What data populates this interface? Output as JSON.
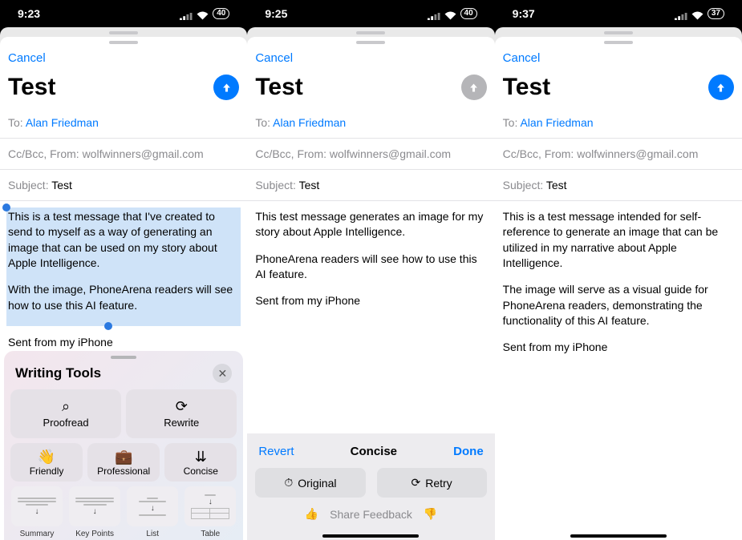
{
  "panels": [
    {
      "status": {
        "time": "9:23",
        "battery": "40"
      },
      "cancel": "Cancel",
      "title": "Test",
      "send_enabled": true,
      "to_label": "To:",
      "to_name": "Alan Friedman",
      "cc_label": "Cc/Bcc, From:",
      "cc_val": "wolfwinners@gmail.com",
      "subj_label": "Subject:",
      "subj_val": "Test",
      "body_selected": [
        "This is a test message that I've created to send to myself as a way of generating an image that can be used on my story about Apple Intelligence.",
        "With the image, PhoneArena readers will see how to use this AI feature."
      ],
      "signature": "Sent from my iPhone",
      "writing_tools": {
        "title": "Writing Tools",
        "proofread": "Proofread",
        "rewrite": "Rewrite",
        "friendly": "Friendly",
        "professional": "Professional",
        "concise": "Concise",
        "summary": "Summary",
        "key_points": "Key Points",
        "list": "List",
        "table": "Table"
      }
    },
    {
      "status": {
        "time": "9:25",
        "battery": "40"
      },
      "cancel": "Cancel",
      "title": "Test",
      "send_enabled": false,
      "to_label": "To:",
      "to_name": "Alan Friedman",
      "cc_label": "Cc/Bcc, From:",
      "cc_val": "wolfwinners@gmail.com",
      "subj_label": "Subject:",
      "subj_val": "Test",
      "body": [
        "This test message generates an image for my story about Apple Intelligence.",
        "PhoneArena readers will see how to use this AI feature.",
        "Sent from my iPhone"
      ],
      "concise_bar": {
        "revert": "Revert",
        "title": "Concise",
        "done": "Done",
        "original": "Original",
        "retry": "Retry",
        "share_feedback": "Share Feedback"
      }
    },
    {
      "status": {
        "time": "9:37",
        "battery": "37"
      },
      "cancel": "Cancel",
      "title": "Test",
      "send_enabled": true,
      "to_label": "To:",
      "to_name": "Alan Friedman",
      "cc_label": "Cc/Bcc, From:",
      "cc_val": "wolfwinners@gmail.com",
      "subj_label": "Subject:",
      "subj_val": "Test",
      "body": [
        "This is a test message intended for self-reference to generate an image that can be utilized in my narrative about Apple Intelligence.",
        "The image will serve as a visual guide for PhoneArena readers, demonstrating the functionality of this AI feature.",
        "Sent from my iPhone"
      ]
    }
  ]
}
